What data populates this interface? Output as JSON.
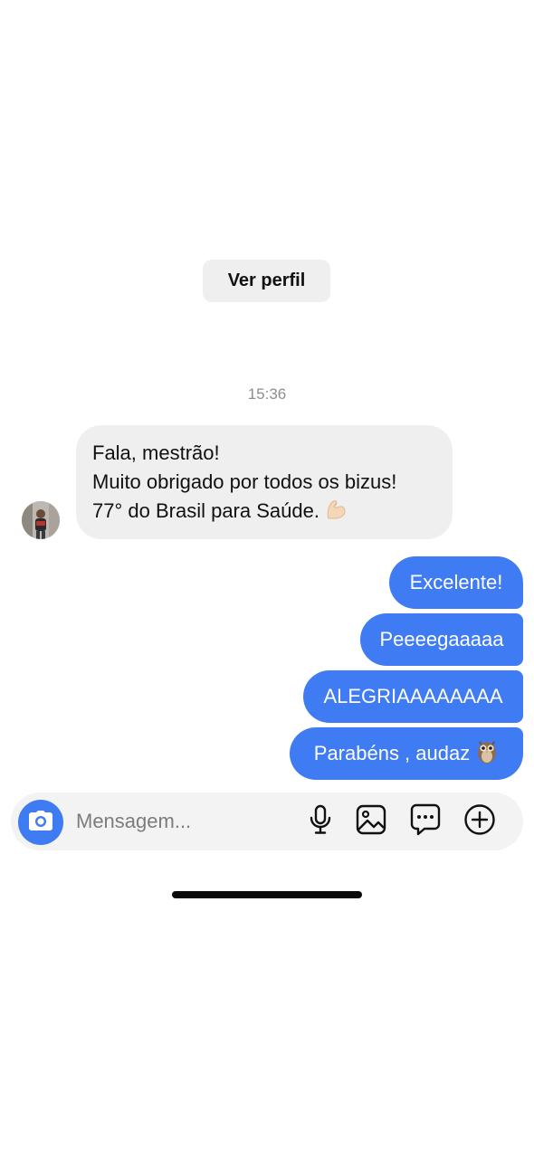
{
  "header": {
    "view_profile_label": "Ver perfil"
  },
  "thread": {
    "timestamp": "15:36",
    "incoming": {
      "lines": [
        "Fala, mestrão!",
        "Muito obrigado por todos os bizus!",
        "77° do Brasil para Saúde."
      ],
      "emoji": "flexed-biceps-emoji"
    },
    "outgoing": [
      {
        "text": "Excelente!"
      },
      {
        "text": "Peeeegaaaaa"
      },
      {
        "text": "ALEGRIAAAAAAAA"
      },
      {
        "text": "Parabéns , audaz",
        "emoji": "owl-emoji"
      }
    ]
  },
  "composer": {
    "placeholder": "Mensagem...",
    "icons": [
      "camera-icon",
      "microphone-icon",
      "gallery-icon",
      "sticker-icon",
      "plus-icon"
    ]
  },
  "colors": {
    "accent": "#3f7bf2",
    "incoming_bubble": "#efefef",
    "composer_bg": "#f3f3f3",
    "timestamp": "#8e8e8e"
  }
}
